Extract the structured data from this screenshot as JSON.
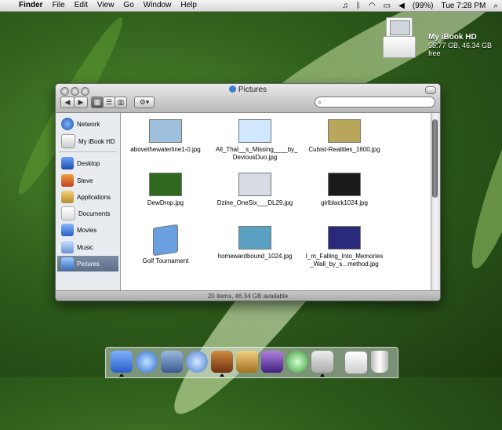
{
  "menubar": {
    "apple": "",
    "app": "Finder",
    "menus": [
      "File",
      "Edit",
      "View",
      "Go",
      "Window",
      "Help"
    ],
    "battery": "(99%)",
    "clock": "Tue 7:28 PM"
  },
  "desktop_drive": {
    "name": "My iBook HD",
    "info": "55.77 GB, 46.34 GB free"
  },
  "window": {
    "title": "Pictures",
    "status": "20 items, 46.34 GB available",
    "search_placeholder": ""
  },
  "sidebar": {
    "items": [
      "Network",
      "My iBook HD",
      "Desktop",
      "Steve",
      "Applications",
      "Documents",
      "Movies",
      "Music",
      "Pictures"
    ],
    "selected": "Pictures"
  },
  "files": [
    {
      "l1": "abovethewaterline1-0.jpg",
      "l2": "",
      "color": "#9fc0dc"
    },
    {
      "l1": "All_That__s_Missing____by_",
      "l2": "DeviousDuo.jpg",
      "color": "#cfe8ff"
    },
    {
      "l1": "Cubist-Realities_1600.jpg",
      "l2": "",
      "color": "#b8a65a"
    },
    {
      "l1": "DewDrop.jpg",
      "l2": "",
      "color": "#2f6a1e"
    },
    {
      "l1": "Dzine_OneSix___DL29.jpg",
      "l2": "",
      "color": "#d6dbe4"
    },
    {
      "l1": "girlblack1024.jpg",
      "l2": "",
      "color": "#1a1a1a"
    },
    {
      "l1": "Golf Tournament",
      "l2": "",
      "color": "#6aa0e0"
    },
    {
      "l1": "homewardbound_1024.jpg",
      "l2": "",
      "color": "#5aa0c0"
    },
    {
      "l1": "I_m_Falling_Into_Memories",
      "l2": "_Wall_by_s...method.jpg",
      "color": "#2a2a7a"
    }
  ]
}
